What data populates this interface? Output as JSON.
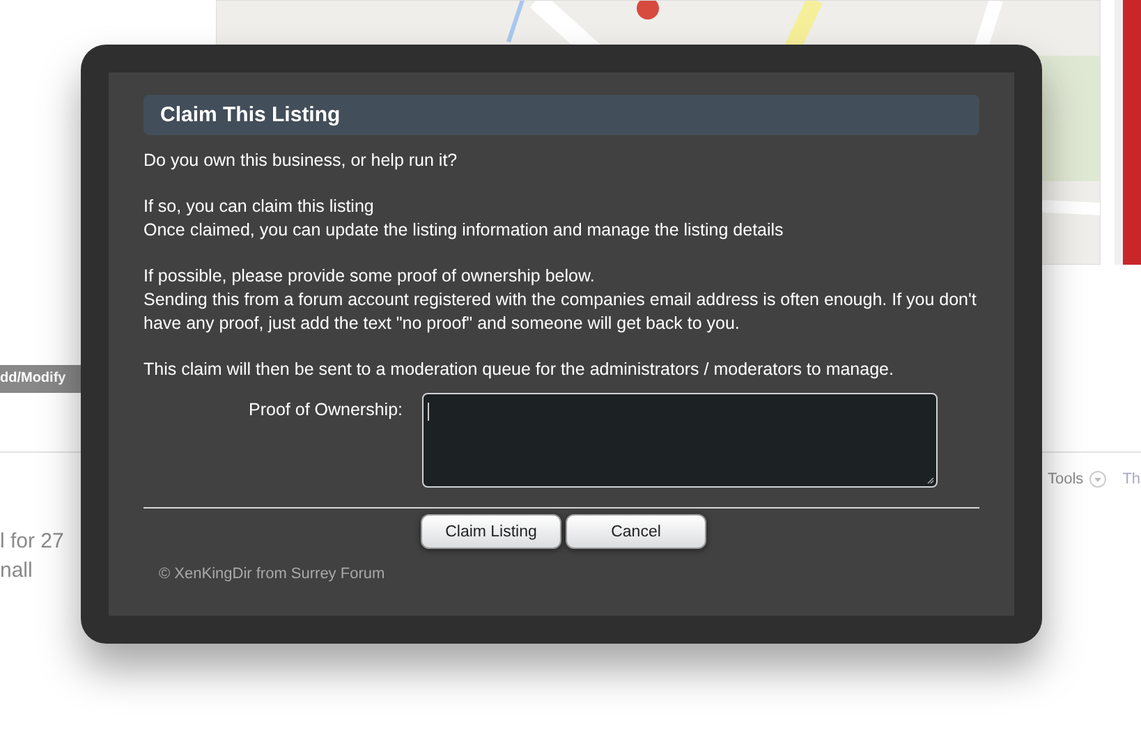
{
  "page": {
    "category_button": "dd/Modify",
    "tools_menu": "Tools",
    "tab_fragment": "Th",
    "listing_lines": [
      "l for 27",
      "nall"
    ]
  },
  "dialog": {
    "title": "Claim This Listing",
    "paragraphs": [
      [
        "Do you own this business, or help run it?"
      ],
      [
        "If so, you can claim this listing",
        "Once claimed, you can update the listing information and manage the listing details"
      ],
      [
        "If possible, please provide some proof of ownership below.",
        "Sending this from a forum account registered with the companies email address is often enough. If you don't have any proof, just add the text \"no proof\" and someone will get back to you."
      ],
      [
        "This claim will then be sent to a moderation queue for the administrators / moderators to manage."
      ]
    ],
    "field": {
      "label": "Proof of Ownership:",
      "focused": true
    },
    "buttons": [
      "Claim Listing",
      "Cancel"
    ],
    "credit": "© XenKingDir from Surrey Forum"
  }
}
